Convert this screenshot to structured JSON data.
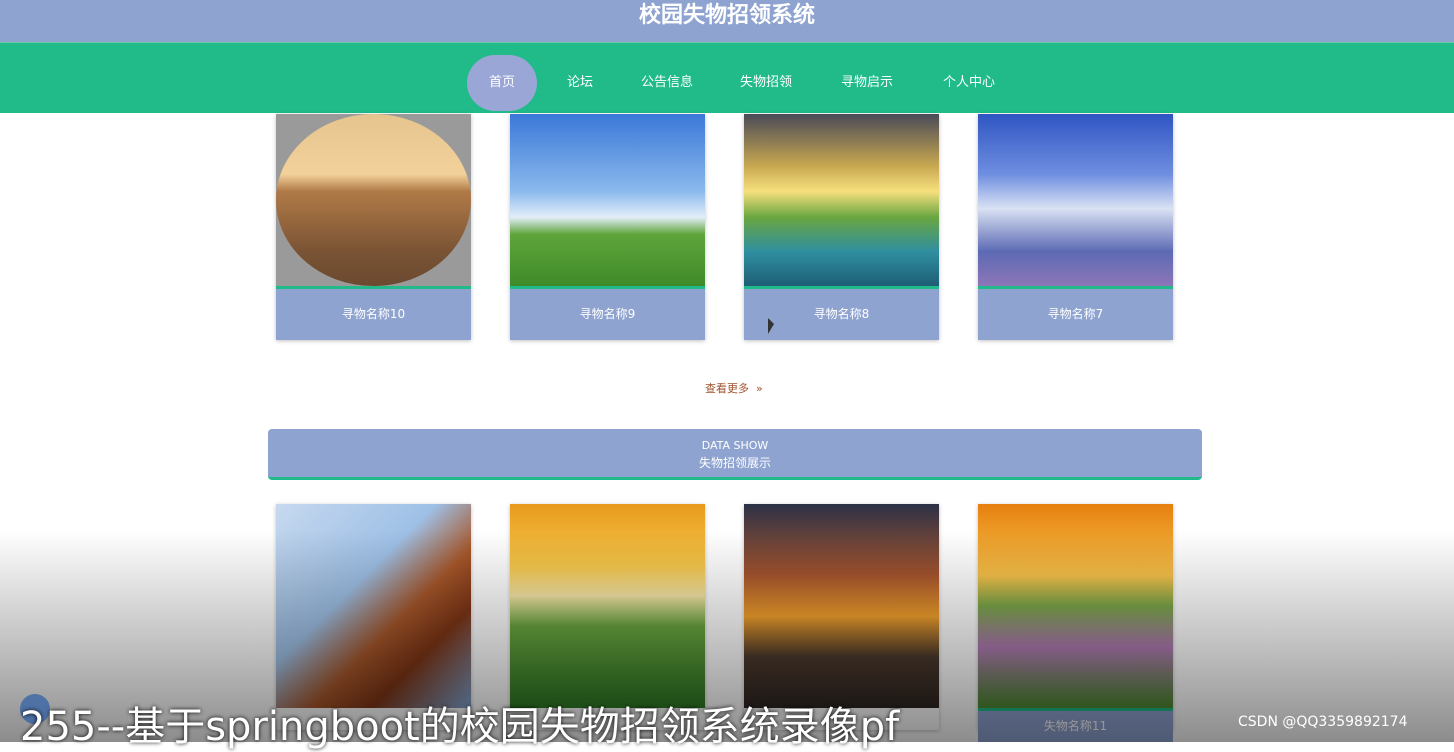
{
  "header": {
    "title": "校园失物招领系统"
  },
  "nav": {
    "items": [
      {
        "label": "首页"
      },
      {
        "label": "论坛"
      },
      {
        "label": "公告信息"
      },
      {
        "label": "失物招领"
      },
      {
        "label": "寻物启示"
      },
      {
        "label": "个人中心"
      }
    ]
  },
  "lost_items": {
    "cards": [
      {
        "label": "寻物名称10"
      },
      {
        "label": "寻物名称9"
      },
      {
        "label": "寻物名称8"
      },
      {
        "label": "寻物名称7"
      }
    ],
    "more_label": "查看更多"
  },
  "found_section": {
    "title_en": "DATA SHOW",
    "title_zh": "失物招领展示",
    "cards": [
      {
        "label": ""
      },
      {
        "label": ""
      },
      {
        "label": ""
      },
      {
        "label": "失物名称11"
      }
    ]
  },
  "overlay": {
    "video_caption": "255--基于springboot的校园失物招领系统录像pf",
    "watermark": "CSDN @QQ3359892174"
  },
  "colors": {
    "header": "#8fa3d1",
    "nav": "#20bb88",
    "accent": "#20bb88"
  }
}
